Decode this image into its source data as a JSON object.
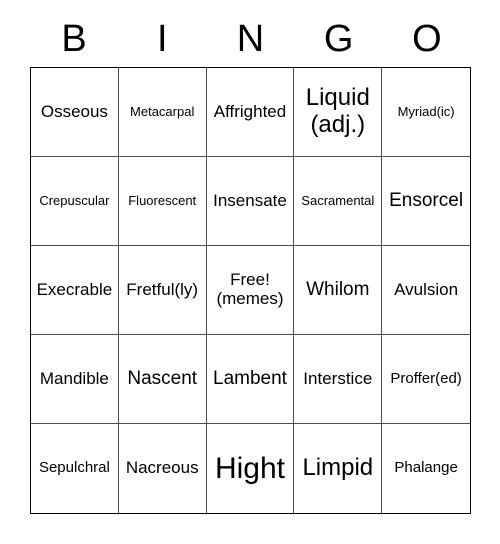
{
  "card": {
    "title_letters": [
      "B",
      "I",
      "N",
      "G",
      "O"
    ],
    "columns": 5,
    "rows": 5,
    "border_color": "#000000",
    "grid_line_color": "#4d4d4d",
    "background_color": "#ffffff",
    "text_color": "#000000"
  },
  "cells": [
    {
      "text": "Osseous",
      "size": "md"
    },
    {
      "text": "Metacarpal",
      "size": "xs"
    },
    {
      "text": "Affrighted",
      "size": "md"
    },
    {
      "text": "Liquid\n(adj.)",
      "size": "xl"
    },
    {
      "text": "Myriad(ic)",
      "size": "xs"
    },
    {
      "text": "Crepuscular",
      "size": "xs"
    },
    {
      "text": "Fluorescent",
      "size": "xs"
    },
    {
      "text": "Insensate",
      "size": "md"
    },
    {
      "text": "Sacramental",
      "size": "xs"
    },
    {
      "text": "Ensorcel",
      "size": "lg"
    },
    {
      "text": "Execrable",
      "size": "md"
    },
    {
      "text": "Fretful(ly)",
      "size": "md"
    },
    {
      "text": "Free!\n(memes)",
      "size": "md"
    },
    {
      "text": "Whilom",
      "size": "lg"
    },
    {
      "text": "Avulsion",
      "size": "md"
    },
    {
      "text": "Mandible",
      "size": "md"
    },
    {
      "text": "Nascent",
      "size": "lg"
    },
    {
      "text": "Lambent",
      "size": "lg"
    },
    {
      "text": "Interstice",
      "size": "md"
    },
    {
      "text": "Proffer(ed)",
      "size": "sm"
    },
    {
      "text": "Sepulchral",
      "size": "sm"
    },
    {
      "text": "Nacreous",
      "size": "md"
    },
    {
      "text": "Hight",
      "size": "xxl"
    },
    {
      "text": "Limpid",
      "size": "xl"
    },
    {
      "text": "Phalange",
      "size": "sm"
    }
  ]
}
